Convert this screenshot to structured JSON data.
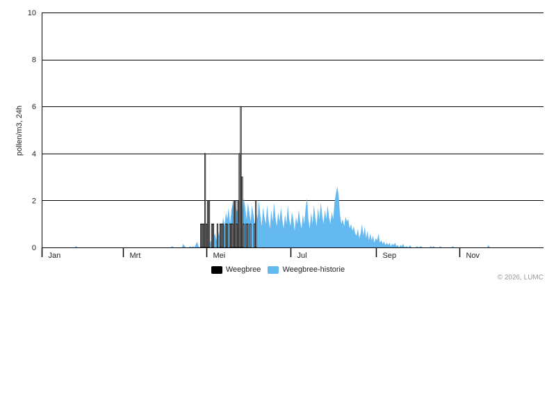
{
  "chart_data": {
    "type": "bar",
    "title": "",
    "xlabel": "",
    "ylabel": "pollen/m3, 24h",
    "ylim": [
      0,
      10
    ],
    "yticks": [
      0,
      2,
      4,
      6,
      8,
      10
    ],
    "xlim_day": [
      1,
      366
    ],
    "month_ticks": [
      {
        "label": "Jan",
        "day": 1
      },
      {
        "label": "Mrt",
        "day": 60
      },
      {
        "label": "Mei",
        "day": 121
      },
      {
        "label": "Jul",
        "day": 182
      },
      {
        "label": "Sep",
        "day": 244
      },
      {
        "label": "Nov",
        "day": 305
      }
    ],
    "grid": true,
    "legend_position": "bottom-center",
    "colors": {
      "weegbree": "#000000",
      "historie": "#64b9f0"
    },
    "series": [
      {
        "name": "Weegbree",
        "type": "bar",
        "points": [
          [
            117,
            1
          ],
          [
            118,
            1
          ],
          [
            119,
            1
          ],
          [
            120,
            4
          ],
          [
            121,
            1
          ],
          [
            122,
            2
          ],
          [
            123,
            2
          ],
          [
            125,
            1
          ],
          [
            126,
            1
          ],
          [
            129,
            1
          ],
          [
            131,
            1
          ],
          [
            132,
            1
          ],
          [
            133,
            1
          ],
          [
            135,
            1
          ],
          [
            136,
            1
          ],
          [
            138,
            1
          ],
          [
            139,
            1
          ],
          [
            140,
            1
          ],
          [
            141,
            2
          ],
          [
            142,
            2
          ],
          [
            143,
            1
          ],
          [
            144,
            2
          ],
          [
            145,
            4
          ],
          [
            146,
            6
          ],
          [
            147,
            3
          ],
          [
            148,
            1
          ],
          [
            150,
            1
          ],
          [
            151,
            1
          ],
          [
            153,
            1
          ],
          [
            156,
            1
          ],
          [
            157,
            2
          ]
        ]
      },
      {
        "name": "Weegbree-historie",
        "type": "area",
        "points": [
          [
            1,
            0
          ],
          [
            25,
            0
          ],
          [
            26,
            0.05
          ],
          [
            27,
            0
          ],
          [
            95,
            0
          ],
          [
            96,
            0.05
          ],
          [
            97,
            0
          ],
          [
            103,
            0
          ],
          [
            104,
            0.15
          ],
          [
            105,
            0.05
          ],
          [
            106,
            0
          ],
          [
            108,
            0
          ],
          [
            109,
            0.05
          ],
          [
            110,
            0
          ],
          [
            111,
            0.05
          ],
          [
            112,
            0
          ],
          [
            113,
            0.1
          ],
          [
            114,
            0.25
          ],
          [
            115,
            0.05
          ],
          [
            116,
            0
          ],
          [
            118,
            0.1
          ],
          [
            119,
            0.2
          ],
          [
            120,
            0.1
          ],
          [
            121,
            0.05
          ],
          [
            122,
            0.2
          ],
          [
            123,
            0.1
          ],
          [
            124,
            0.3
          ],
          [
            125,
            0.1
          ],
          [
            126,
            0.4
          ],
          [
            127,
            0.6
          ],
          [
            128,
            0.3
          ],
          [
            129,
            0.8
          ],
          [
            130,
            0.5
          ],
          [
            131,
            1.0
          ],
          [
            132,
            0.7
          ],
          [
            133,
            1.3
          ],
          [
            134,
            0.9
          ],
          [
            135,
            1.5
          ],
          [
            136,
            1.2
          ],
          [
            137,
            1.7
          ],
          [
            138,
            1.0
          ],
          [
            139,
            1.6
          ],
          [
            140,
            1.9
          ],
          [
            141,
            1.2
          ],
          [
            142,
            1.8
          ],
          [
            143,
            1.5
          ],
          [
            144,
            2.0
          ],
          [
            145,
            1.4
          ],
          [
            146,
            1.9
          ],
          [
            147,
            1.3
          ],
          [
            148,
            2.1
          ],
          [
            149,
            1.7
          ],
          [
            150,
            1.2
          ],
          [
            151,
            1.9
          ],
          [
            152,
            1.5
          ],
          [
            153,
            1.1
          ],
          [
            154,
            1.8
          ],
          [
            155,
            1.4
          ],
          [
            156,
            1.0
          ],
          [
            157,
            1.6
          ],
          [
            158,
            1.2
          ],
          [
            159,
            2.0
          ],
          [
            160,
            1.4
          ],
          [
            161,
            0.9
          ],
          [
            162,
            1.7
          ],
          [
            163,
            1.3
          ],
          [
            164,
            1.0
          ],
          [
            165,
            1.8
          ],
          [
            166,
            1.2
          ],
          [
            167,
            0.8
          ],
          [
            168,
            1.6
          ],
          [
            169,
            1.1
          ],
          [
            170,
            1.9
          ],
          [
            171,
            1.3
          ],
          [
            172,
            0.9
          ],
          [
            173,
            1.5
          ],
          [
            174,
            1.1
          ],
          [
            175,
            1.7
          ],
          [
            176,
            1.2
          ],
          [
            177,
            0.8
          ],
          [
            178,
            1.4
          ],
          [
            179,
            1.0
          ],
          [
            180,
            1.8
          ],
          [
            181,
            1.2
          ],
          [
            182,
            0.9
          ],
          [
            183,
            1.5
          ],
          [
            184,
            1.2
          ],
          [
            185,
            0.7
          ],
          [
            186,
            1.3
          ],
          [
            187,
            1.0
          ],
          [
            188,
            1.6
          ],
          [
            189,
            1.1
          ],
          [
            190,
            0.8
          ],
          [
            191,
            1.4
          ],
          [
            192,
            1.0
          ],
          [
            193,
            1.7
          ],
          [
            194,
            2.1
          ],
          [
            195,
            1.2
          ],
          [
            196,
            0.8
          ],
          [
            197,
            1.5
          ],
          [
            198,
            1.0
          ],
          [
            199,
            1.8
          ],
          [
            200,
            1.3
          ],
          [
            201,
            0.9
          ],
          [
            202,
            1.7
          ],
          [
            203,
            1.2
          ],
          [
            204,
            1.9
          ],
          [
            205,
            1.4
          ],
          [
            206,
            1.0
          ],
          [
            207,
            1.6
          ],
          [
            208,
            1.2
          ],
          [
            209,
            1.8
          ],
          [
            210,
            1.3
          ],
          [
            211,
            1.0
          ],
          [
            212,
            1.5
          ],
          [
            213,
            1.2
          ],
          [
            214,
            1.9
          ],
          [
            215,
            2.3
          ],
          [
            216,
            2.6
          ],
          [
            217,
            2.2
          ],
          [
            218,
            1.4
          ],
          [
            219,
            1.0
          ],
          [
            220,
            1.2
          ],
          [
            221,
            0.9
          ],
          [
            222,
            1.3
          ],
          [
            223,
            1.1
          ],
          [
            224,
            1.2
          ],
          [
            225,
            0.8
          ],
          [
            226,
            1.0
          ],
          [
            227,
            0.7
          ],
          [
            228,
            0.9
          ],
          [
            229,
            0.6
          ],
          [
            230,
            0.5
          ],
          [
            231,
            0.8
          ],
          [
            232,
            0.4
          ],
          [
            233,
            0.6
          ],
          [
            234,
            1.0
          ],
          [
            235,
            0.5
          ],
          [
            236,
            0.9
          ],
          [
            237,
            0.4
          ],
          [
            238,
            0.7
          ],
          [
            239,
            0.3
          ],
          [
            240,
            0.6
          ],
          [
            241,
            0.3
          ],
          [
            242,
            0.5
          ],
          [
            243,
            0.2
          ],
          [
            244,
            0.4
          ],
          [
            245,
            0.3
          ],
          [
            246,
            0.6
          ],
          [
            247,
            0.2
          ],
          [
            248,
            0.3
          ],
          [
            249,
            0.15
          ],
          [
            250,
            0.25
          ],
          [
            251,
            0.1
          ],
          [
            252,
            0.2
          ],
          [
            253,
            0.1
          ],
          [
            254,
            0.2
          ],
          [
            255,
            0.05
          ],
          [
            256,
            0.15
          ],
          [
            257,
            0.1
          ],
          [
            258,
            0.2
          ],
          [
            259,
            0.05
          ],
          [
            260,
            0.1
          ],
          [
            261,
            0
          ],
          [
            262,
            0.1
          ],
          [
            263,
            0.05
          ],
          [
            264,
            0.15
          ],
          [
            265,
            0
          ],
          [
            266,
            0.05
          ],
          [
            268,
            0
          ],
          [
            269,
            0.1
          ],
          [
            270,
            0
          ],
          [
            273,
            0
          ],
          [
            274,
            0.05
          ],
          [
            275,
            0
          ],
          [
            277,
            0.05
          ],
          [
            278,
            0
          ],
          [
            283,
            0
          ],
          [
            284,
            0.05
          ],
          [
            285,
            0
          ],
          [
            286,
            0.05
          ],
          [
            287,
            0
          ],
          [
            290,
            0
          ],
          [
            291,
            0.05
          ],
          [
            292,
            0
          ],
          [
            299,
            0
          ],
          [
            300,
            0.05
          ],
          [
            301,
            0
          ],
          [
            325,
            0
          ],
          [
            326,
            0.1
          ],
          [
            327,
            0
          ],
          [
            366,
            0
          ]
        ]
      }
    ]
  },
  "legend": {
    "items": [
      {
        "label": "Weegbree",
        "color": "#000000"
      },
      {
        "label": "Weegbree-historie",
        "color": "#64b9f0"
      }
    ]
  },
  "credit": "© 2026, LUMC"
}
